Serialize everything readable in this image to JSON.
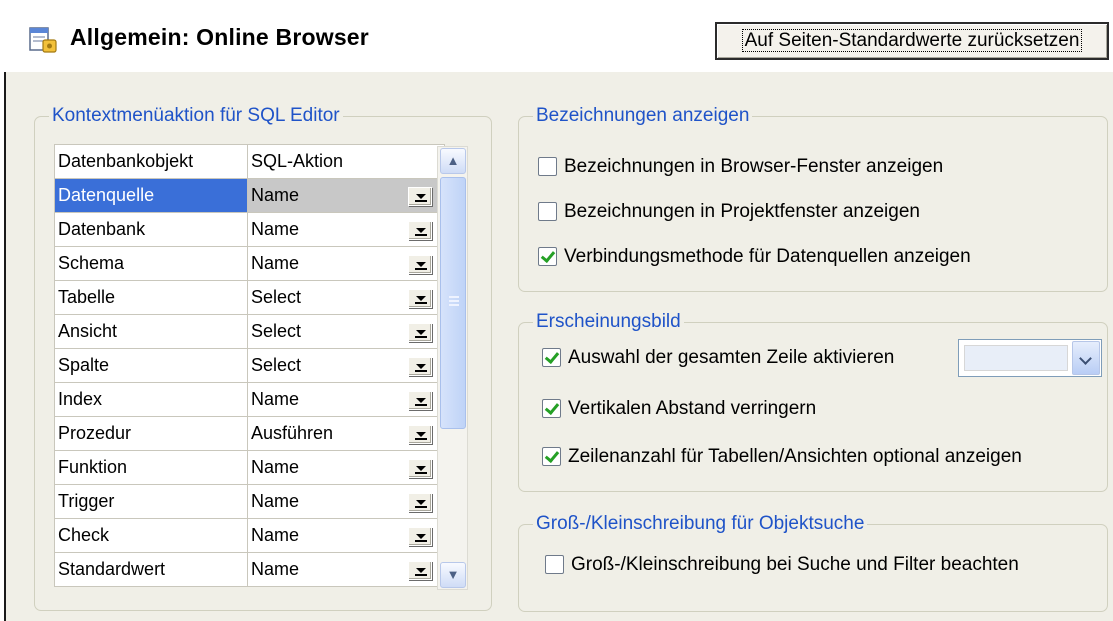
{
  "header": {
    "title": "Allgemein: Online Browser",
    "reset_button": "Auf Seiten-Standardwerte zurücksetzen",
    "icon": "page-settings-icon"
  },
  "sql_group": {
    "legend": "Kontextmenüaktion für SQL Editor",
    "columns": [
      "Datenbankobjekt",
      "SQL-Aktion"
    ],
    "rows": [
      {
        "object": "Datenquelle",
        "action": "Name"
      },
      {
        "object": "Datenbank",
        "action": "Name"
      },
      {
        "object": "Schema",
        "action": "Name"
      },
      {
        "object": "Tabelle",
        "action": "Select"
      },
      {
        "object": "Ansicht",
        "action": "Select"
      },
      {
        "object": "Spalte",
        "action": "Select"
      },
      {
        "object": "Index",
        "action": "Name"
      },
      {
        "object": "Prozedur",
        "action": "Ausführen"
      },
      {
        "object": "Funktion",
        "action": "Name"
      },
      {
        "object": "Trigger",
        "action": "Name"
      },
      {
        "object": "Check",
        "action": "Name"
      },
      {
        "object": "Standardwert",
        "action": "Name"
      }
    ],
    "selected_row": 0
  },
  "labels_group": {
    "legend": "Bezeichnungen anzeigen",
    "items": [
      {
        "label": "Bezeichnungen in Browser-Fenster anzeigen",
        "checked": false
      },
      {
        "label": "Bezeichnungen in Projektfenster anzeigen",
        "checked": false
      },
      {
        "label": "Verbindungsmethode für Datenquellen anzeigen",
        "checked": true
      }
    ]
  },
  "appearance_group": {
    "legend": "Erscheinungsbild",
    "items": [
      {
        "label": "Auswahl der gesamten Zeile aktivieren",
        "checked": true
      },
      {
        "label": "Vertikalen Abstand verringern",
        "checked": true
      },
      {
        "label": "Zeilenanzahl für Tabellen/Ansichten optional anzeigen",
        "checked": true
      }
    ],
    "row_color": "#e8eef8"
  },
  "case_group": {
    "legend": "Groß-/Kleinschreibung für Objektsuche",
    "items": [
      {
        "label": "Groß-/Kleinschreibung bei Suche und Filter beachten",
        "checked": false
      }
    ]
  },
  "colors": {
    "legend_text": "#1f53c8",
    "selection": "#3a6fd8",
    "panel_bg": "#f0efe7",
    "check": "#25a025"
  }
}
